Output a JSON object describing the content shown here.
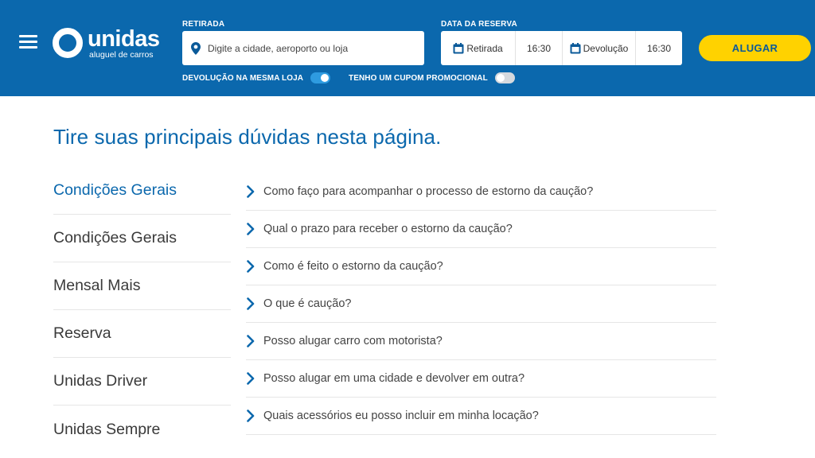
{
  "header": {
    "brand": {
      "name": "unidas",
      "tagline": "aluguel de carros"
    },
    "pickup": {
      "label": "RETIRADA",
      "placeholder": "Digite a cidade, aeroporto ou loja"
    },
    "reservation": {
      "label": "DATA DA RESERVA",
      "pickup_label": "Retirada",
      "pickup_time": "16:30",
      "return_label": "Devolução",
      "return_time": "16:30"
    },
    "rent_button": "ALUGAR",
    "toggles": [
      {
        "label": "DEVOLUÇÃO NA MESMA LOJA",
        "on": true
      },
      {
        "label": "TENHO UM CUPOM PROMOCIONAL",
        "on": false
      }
    ]
  },
  "main": {
    "title": "Tire suas principais dúvidas nesta página.",
    "categories": [
      {
        "label": "Condições Gerais",
        "active": true
      },
      {
        "label": "Condições Gerais",
        "active": false
      },
      {
        "label": "Mensal Mais",
        "active": false
      },
      {
        "label": "Reserva",
        "active": false
      },
      {
        "label": "Unidas Driver",
        "active": false
      },
      {
        "label": "Unidas Sempre",
        "active": false
      }
    ],
    "faqs": [
      "Como faço para acompanhar o processo de estorno da caução?",
      "Qual o prazo para receber o estorno da caução?",
      "Como é feito o estorno da caução?",
      "O que é caução?",
      "Posso alugar carro com motorista?",
      "Posso alugar em uma cidade e devolver em outra?",
      "Quais acessórios eu posso incluir em minha locação?"
    ]
  },
  "colors": {
    "brand_blue": "#0b68ad",
    "accent_yellow": "#ffd200",
    "toggle_on": "#2e9be0",
    "toggle_off": "#d5d9de"
  },
  "icons": {
    "menu": "hamburger-menu-icon",
    "pickup": "location-pin-icon",
    "calendar": "calendar-icon",
    "faq": "chevron-right-icon"
  }
}
